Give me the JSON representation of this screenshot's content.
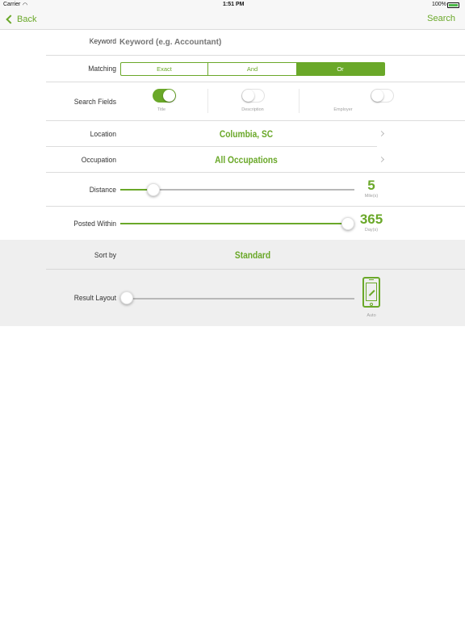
{
  "status_bar": {
    "carrier": "Carrier",
    "time": "1:51 PM",
    "battery": "100%"
  },
  "nav": {
    "back_label": "Back",
    "search_label": "Search"
  },
  "keyword": {
    "label": "Keyword",
    "placeholder": "Keyword (e.g. Accountant)"
  },
  "matching": {
    "label": "Matching",
    "options": [
      "Exact",
      "And",
      "Or"
    ],
    "selected": "Or"
  },
  "search_fields": {
    "label": "Search Fields",
    "fields": [
      {
        "name": "Title",
        "on": true
      },
      {
        "name": "Description",
        "on": false
      },
      {
        "name": "Employer",
        "on": false
      }
    ]
  },
  "location": {
    "label": "Location",
    "value": "Columbia, SC"
  },
  "occupation": {
    "label": "Occupation",
    "value": "All Occupations"
  },
  "distance": {
    "label": "Distance",
    "value": "5",
    "unit": "Mile(s)",
    "level": 0.12
  },
  "posted_within": {
    "label": "Posted Within",
    "value": "365",
    "unit": "Day(s)",
    "level": 1.0
  },
  "sort_by": {
    "label": "Sort by",
    "value": "Standard"
  },
  "result_layout": {
    "label": "Result Layout",
    "value": "Auto",
    "icon": "phone-auto-icon",
    "level": 0.0
  },
  "colors": {
    "accent": "#6aa829",
    "grey_bg": "#efefef",
    "track": "#b8b8b8"
  }
}
